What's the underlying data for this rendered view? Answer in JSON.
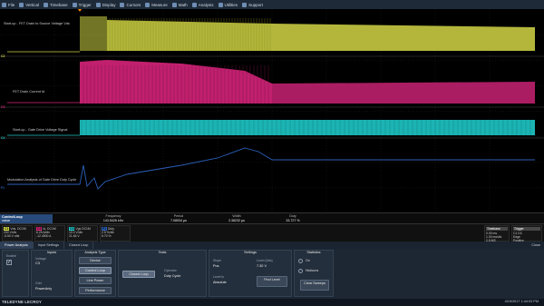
{
  "menu": [
    {
      "label": "File",
      "icon": "file-icon"
    },
    {
      "label": "Vertical",
      "icon": "vertical-icon"
    },
    {
      "label": "Timebase",
      "icon": "timebase-icon"
    },
    {
      "label": "Trigger",
      "icon": "trigger-icon"
    },
    {
      "label": "Display",
      "icon": "display-icon"
    },
    {
      "label": "Cursors",
      "icon": "cursors-icon"
    },
    {
      "label": "Measure",
      "icon": "measure-icon"
    },
    {
      "label": "Math",
      "icon": "math-icon"
    },
    {
      "label": "Analysis",
      "icon": "analysis-icon"
    },
    {
      "label": "Utilities",
      "icon": "utilities-icon"
    },
    {
      "label": "Support",
      "icon": "support-icon"
    }
  ],
  "traces": {
    "c2_label": "Start-up - FET Drain to Source Voltage Vds",
    "c3_label": "FET Drain Current Id",
    "c4_label": "Start-up - Gate Drive Voltage Signal",
    "f1_label": "Modulation Analysis of Gate Drive Duty Cycle",
    "markers": {
      "c2": "C2",
      "c3": "C3",
      "c4": "C4",
      "f1": "F1"
    },
    "colors": {
      "c2": "#d2d645",
      "c3": "#d6247a",
      "c4": "#1fc6c6",
      "f1": "#2b5fb8"
    }
  },
  "measure": {
    "loop_title": "ControlLoop",
    "loop_line2": "value",
    "loop_line3": "status",
    "params": [
      {
        "name": "Frequency",
        "value": "143.5426 kHz"
      },
      {
        "name": "Period",
        "value": "7.08934 µs"
      },
      {
        "name": "Width",
        "value": "2.38232 µs"
      },
      {
        "name": "Duty",
        "value": "33.727 %"
      }
    ]
  },
  "channels": [
    {
      "tag": "C1",
      "color": "#d2d645",
      "lines": [
        "Vds, DC1M",
        "200 V/div",
        "-5.50 V ofst"
      ]
    },
    {
      "tag": "C2",
      "color": "#d6247a",
      "lines": [
        "Id, DC1M",
        "6.25 A/div",
        "-12.4500 A"
      ]
    },
    {
      "tag": "C3",
      "color": "#1fc6c6",
      "lines": [
        "Vgs DC1M",
        "10.0 V/div",
        "21.64 V"
      ]
    },
    {
      "tag": "F1",
      "color": "#2b5fb8",
      "lines": [
        "Duty",
        "2.5 %/div",
        "5.70 %"
      ]
    }
  ],
  "timebase": {
    "head": "Timebase",
    "values": [
      "0.00 ms",
      "1.00 ms/div",
      "2.5 MS",
      "250 MS/s"
    ]
  },
  "trigger": {
    "head": "Trigger",
    "values": [
      "C1 DC",
      "Normal",
      "Edge",
      "Positive",
      "88.0 V"
    ]
  },
  "tabs": [
    {
      "label": "Power Analysis",
      "active": true
    },
    {
      "label": "Input Settings",
      "active": false
    },
    {
      "label": "Closed Loop",
      "active": false
    }
  ],
  "close_label": "Close",
  "panel": {
    "enable_label": "Enable",
    "inputs_title": "Inputs",
    "voltage_label": "Voltage",
    "voltage_value": "C3",
    "grid_label": "Grid",
    "grid_value": "PowerAnly",
    "analysis_title": "Analysis Type",
    "analysis_buttons": [
      {
        "label": "Device",
        "active": false
      },
      {
        "label": "Control Loop",
        "active": true
      },
      {
        "label": "Line Power",
        "active": false
      },
      {
        "label": "Performance",
        "active": false
      }
    ],
    "tests_title": "Tests",
    "tests_button": "Closed Loop",
    "operator_label": "Operator",
    "operator_value": "Duty Cycle",
    "settings_title": "Settings",
    "slope_label": "Slope",
    "slope_value": "Pos",
    "level_mode_label": "Level is",
    "level_mode_value": "Absolute",
    "level_abs_label": "Level (Abs)",
    "level_abs_value": "7.30 V",
    "find_level_button": "Find Level",
    "statistics_title": "Statistics",
    "stat_on_label": "On",
    "histicons_label": "Histicons",
    "clear_sweeps_button": "Clear Sweeps"
  },
  "status": {
    "brand": "TELEDYNE LECROY",
    "datetime": "4/15/2017 1:44:03 PM"
  }
}
